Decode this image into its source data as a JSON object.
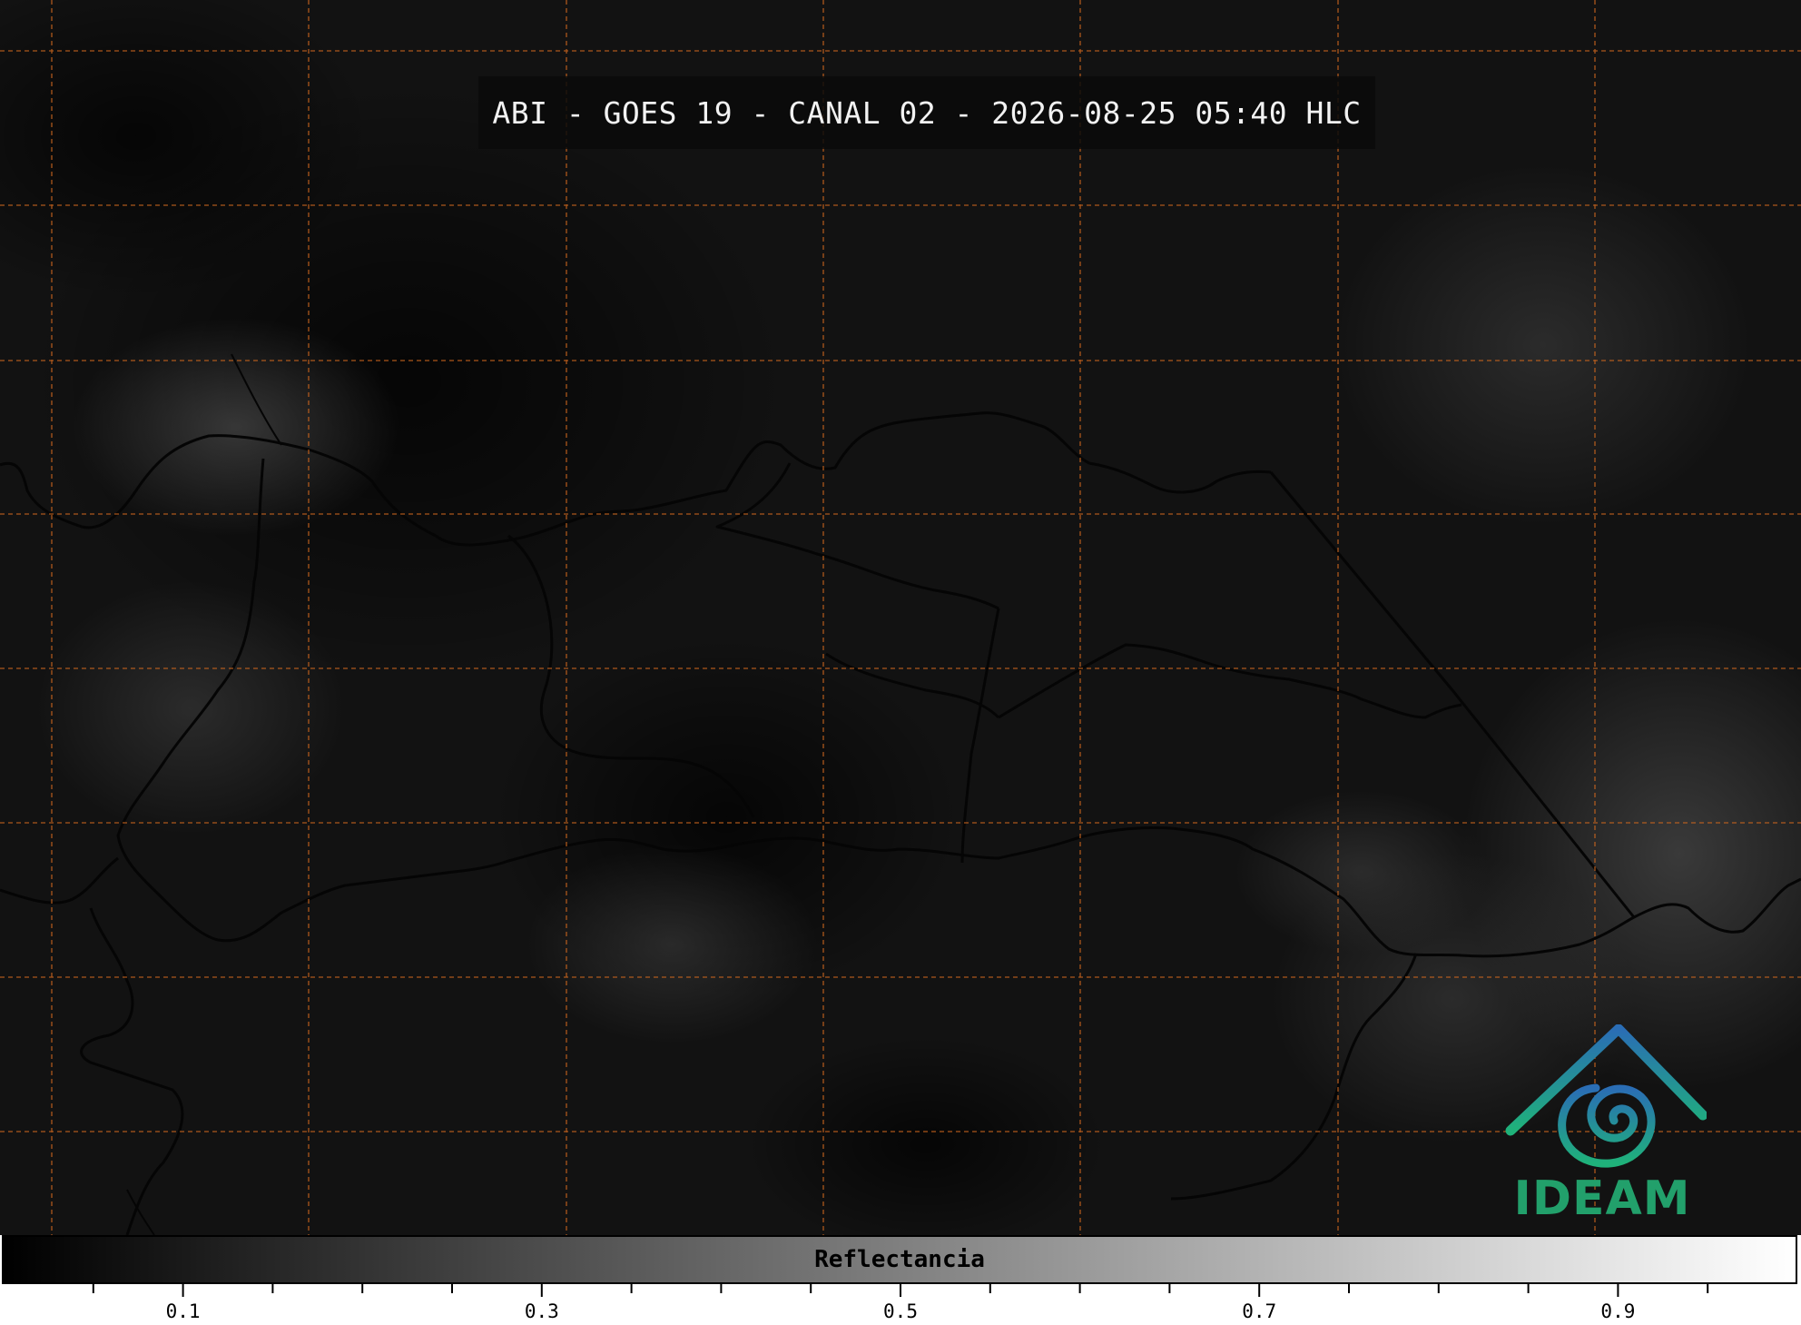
{
  "title": "ABI - GOES 19 - CANAL 02 - 2026-08-25 05:40 HLC",
  "logo": {
    "text": "IDEAM"
  },
  "colorbar": {
    "label": "Reflectancia",
    "range": [
      0.0,
      1.0
    ],
    "ticks": [
      {
        "value": 0.1,
        "label": "0.1"
      },
      {
        "value": 0.3,
        "label": "0.3"
      },
      {
        "value": 0.5,
        "label": "0.5"
      },
      {
        "value": 0.7,
        "label": "0.7"
      },
      {
        "value": 0.9,
        "label": "0.9"
      }
    ],
    "minor_step": 0.05,
    "colormap": [
      "#000000",
      "#ffffff"
    ]
  },
  "colors": {
    "background": "#111111",
    "graticule": "#c8641e",
    "borders": "#000000",
    "logo_teal": "#22a06b",
    "logo_blue": "#2a6db5"
  }
}
